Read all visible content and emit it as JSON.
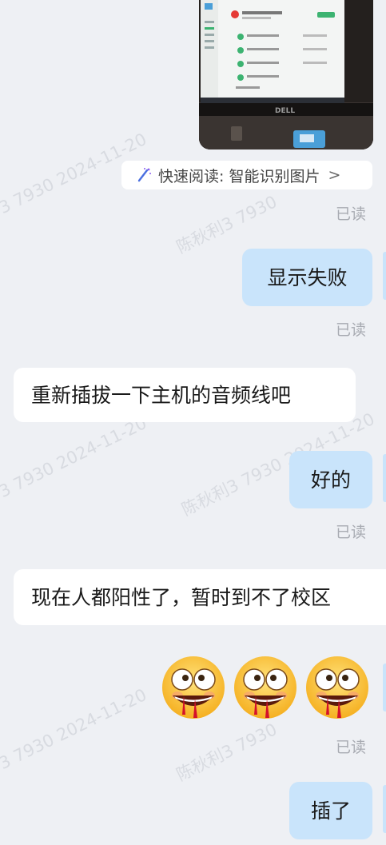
{
  "watermark": {
    "text_a": "3 7930 2024-11-20",
    "text_b": "陈秋利3 7930",
    "text_c": "陈秋利3 7930 2024-11-20"
  },
  "quick_read": {
    "label": "快速阅读: 智能识别图片",
    "chevron": ">",
    "icon": "magic-wand-icon"
  },
  "messages": [
    {
      "id": "m1",
      "sender": "me",
      "text": "显示失败",
      "status": "已读"
    },
    {
      "id": "m2",
      "sender": "other",
      "text": "重新插拔一下主机的音频线吧"
    },
    {
      "id": "m3",
      "sender": "me",
      "text": "好的",
      "status": "已读"
    },
    {
      "id": "m4",
      "sender": "other",
      "text": "现在人都阳性了，暂时到不了校区"
    },
    {
      "id": "m5",
      "sender": "me",
      "emoji_count": 3,
      "emoji": "drooling-bloody-face",
      "status": "已读"
    },
    {
      "id": "m6",
      "sender": "me",
      "text": "插了"
    }
  ],
  "photo": {
    "monitor_brand": "DELL",
    "colors": {
      "bezel": "#1e1b19",
      "screen": "#f4f6f4",
      "accent": "#3cb371",
      "error": "#e53935",
      "sticker": "#4a9fd8"
    }
  },
  "colors": {
    "background": "#eef0f4",
    "my_bubble": "#c9e4fb",
    "their_bubble": "#ffffff",
    "read_receipt": "#a8abb2"
  }
}
